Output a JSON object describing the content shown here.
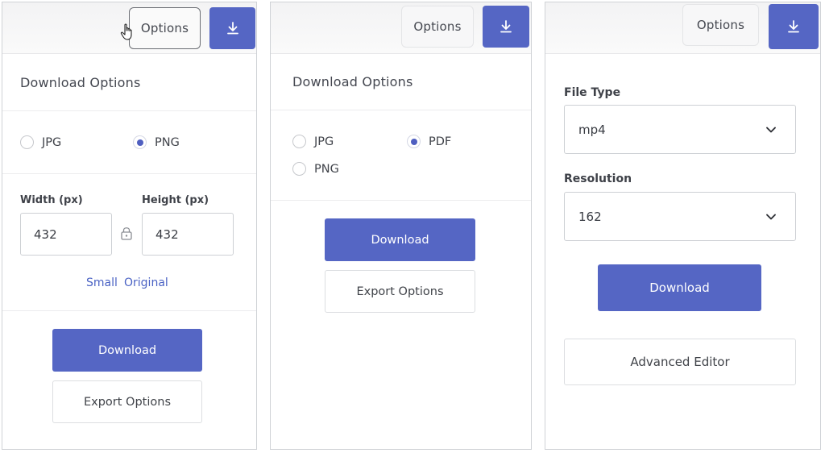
{
  "colors": {
    "accent": "#5566c4",
    "link": "#4a62c4"
  },
  "panel1": {
    "options_label": "Options",
    "download_icon": "download-arrow-icon",
    "title": "Download Options",
    "formats": [
      {
        "label": "JPG",
        "selected": false
      },
      {
        "label": "PNG",
        "selected": true
      }
    ],
    "width_label": "Width (px)",
    "height_label": "Height (px)",
    "width_value": "432",
    "height_value": "432",
    "size_links": [
      "Small",
      "Original"
    ],
    "download_label": "Download",
    "export_label": "Export Options"
  },
  "panel2": {
    "options_label": "Options",
    "download_icon": "download-arrow-icon",
    "title": "Download Options",
    "formats": [
      {
        "label": "JPG",
        "selected": false
      },
      {
        "label": "PDF",
        "selected": true
      },
      {
        "label": "PNG",
        "selected": false
      }
    ],
    "download_label": "Download",
    "export_label": "Export Options"
  },
  "panel3": {
    "options_label": "Options",
    "download_icon": "download-arrow-icon",
    "file_type_label": "File Type",
    "file_type_value": "mp4",
    "resolution_label": "Resolution",
    "resolution_value": "162",
    "download_label": "Download",
    "advanced_label": "Advanced Editor"
  }
}
